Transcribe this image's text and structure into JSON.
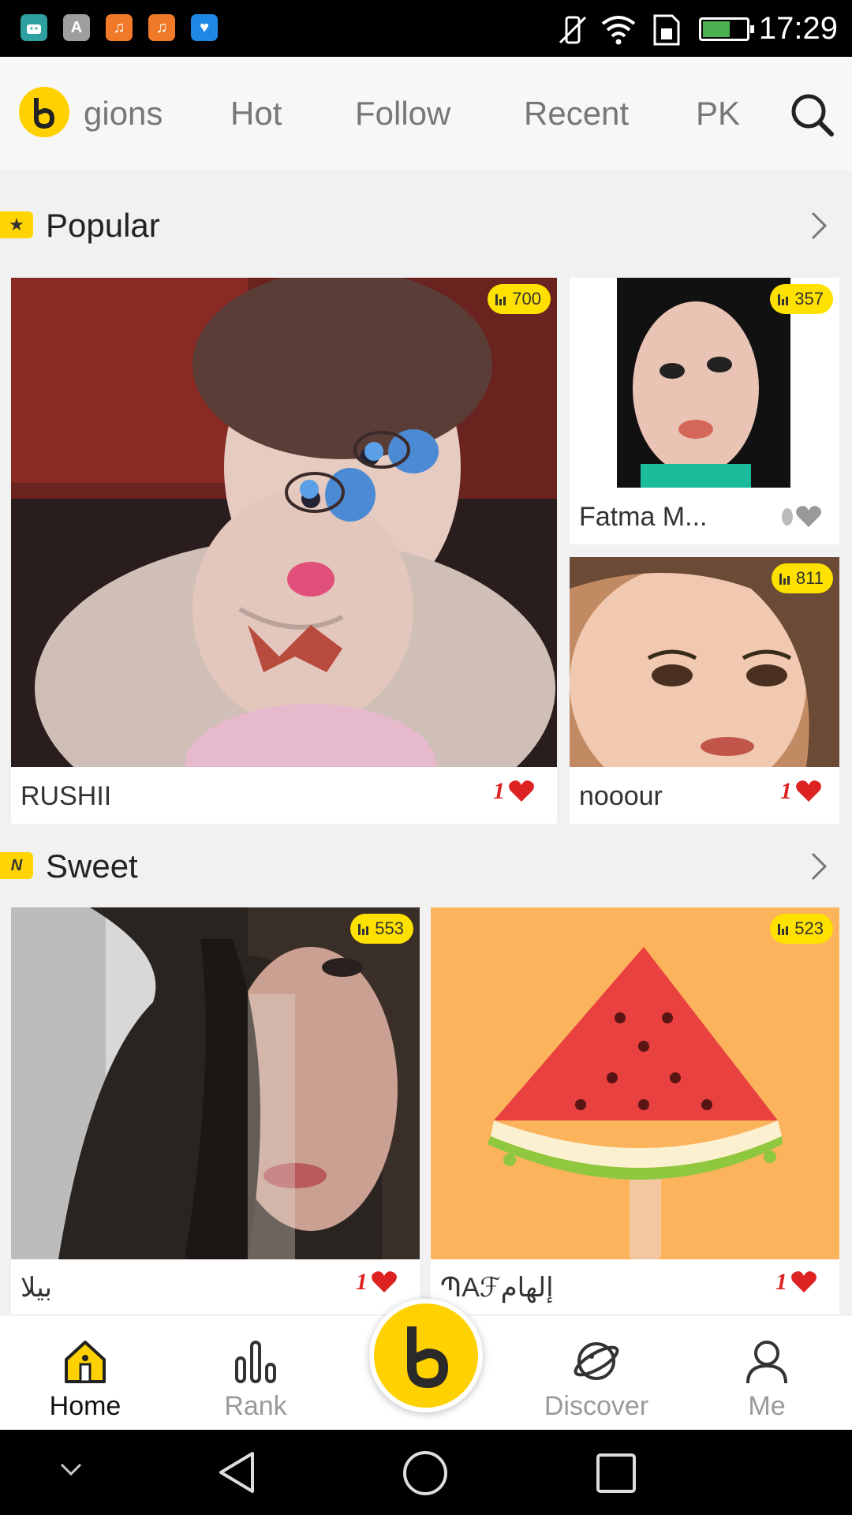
{
  "status_bar": {
    "time": "17:29",
    "app_icons": [
      {
        "name": "android-icon",
        "color": "#2ea0a0"
      },
      {
        "name": "text-a-icon",
        "color": "#9e9e9e"
      },
      {
        "name": "music-icon",
        "color": "#f07a2a"
      },
      {
        "name": "music-icon",
        "color": "#f07a2a"
      },
      {
        "name": "heart-app-icon",
        "color": "#1e88e5"
      }
    ]
  },
  "top_nav": {
    "tabs": [
      "gions",
      "Hot",
      "Follow",
      "Recent",
      "PK"
    ]
  },
  "sections": [
    {
      "title": "Popular",
      "badge": "★",
      "cards": [
        {
          "name": "RUSHII",
          "viewers": "700",
          "likes": "1",
          "image_desc": "photo-woman-blue-eyes",
          "colors": [
            "#7a2420",
            "#c9b2a6",
            "#e9d3c8"
          ]
        },
        {
          "name": "Fatma M...",
          "viewers": "357",
          "likes": "",
          "image_desc": "photo-woman-dark-hair",
          "colors": [
            "#101010",
            "#e8c3b5",
            "#1abc9c"
          ]
        },
        {
          "name": "nooour",
          "viewers": "811",
          "likes": "1",
          "image_desc": "photo-woman-closeup",
          "colors": [
            "#c58a60",
            "#f0c9b0",
            "#5a3a2a"
          ]
        }
      ]
    },
    {
      "title": "Sweet",
      "badge": "N",
      "cards": [
        {
          "name": "بيلا",
          "viewers": "553",
          "likes": "1",
          "image_desc": "photo-woman-long-hair",
          "colors": [
            "#d8d8d8",
            "#2a2420",
            "#b88c7c"
          ]
        },
        {
          "name": "ՊAℱإلهام",
          "viewers": "523",
          "likes": "1",
          "image_desc": "watermelon-illustration",
          "colors": [
            "#fbb35c",
            "#e8413f",
            "#8fc73e"
          ]
        }
      ]
    }
  ],
  "bottom_nav": {
    "items": [
      {
        "label": "Home",
        "active": true
      },
      {
        "label": "Rank",
        "active": false
      },
      {
        "label": "",
        "center": true
      },
      {
        "label": "Discover",
        "active": false
      },
      {
        "label": "Me",
        "active": false
      }
    ]
  },
  "colors": {
    "accent": "#ffd100",
    "like_red": "#d22",
    "text_dark": "#222",
    "text_muted": "#9a9a9a"
  }
}
